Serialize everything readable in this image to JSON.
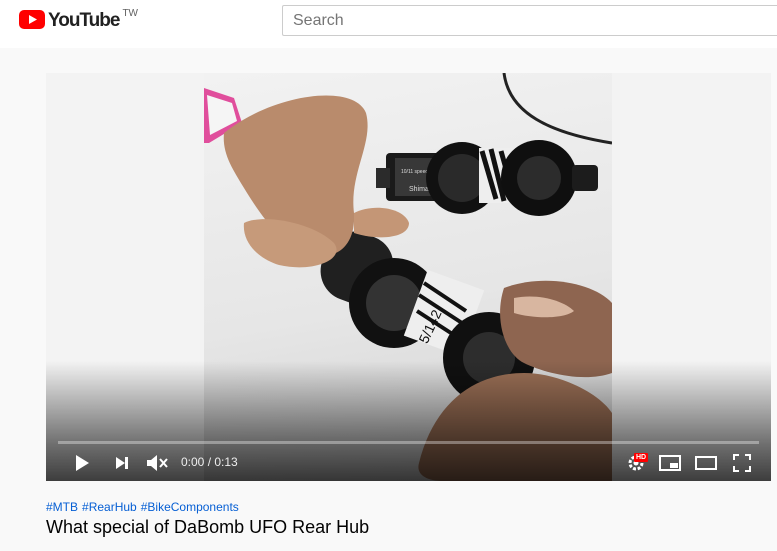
{
  "masthead": {
    "logo_text": "YouTube",
    "region": "TW",
    "search_placeholder": "Search"
  },
  "player": {
    "time_display": "0:00 / 0:13",
    "progress": 0,
    "hd_label": "HD",
    "thumbnail_text": {
      "shimano_label": "Shimano",
      "hub_spec": "5/142"
    },
    "icons": [
      "play-icon",
      "next-icon",
      "mute-icon",
      "settings-icon",
      "miniplayer-icon",
      "theater-icon",
      "fullscreen-icon"
    ]
  },
  "video": {
    "hashtags": [
      "#MTB",
      "#RearHub",
      "#BikeComponents"
    ],
    "title": "What special of DaBomb UFO Rear Hub"
  },
  "colors": {
    "brand_red": "#ff0000",
    "link_blue": "#065fd4"
  }
}
